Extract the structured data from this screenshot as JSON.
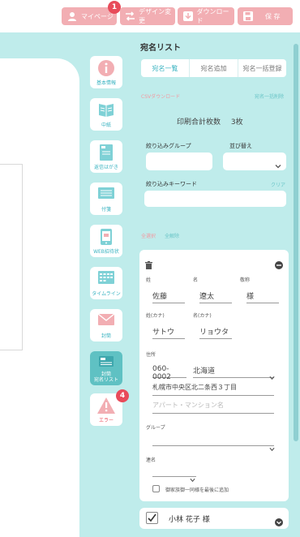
{
  "header": {
    "mypage_label": "マイページ",
    "design_change_label": "デザイン変更",
    "download_label": "ダウンロード",
    "save_label": "保 存",
    "mypage_badge": "1"
  },
  "nav": {
    "items": [
      {
        "label": "基本情報"
      },
      {
        "label": "中紙"
      },
      {
        "label": "返信はがき"
      },
      {
        "label": "付箋"
      },
      {
        "label": "WEB招待状"
      },
      {
        "label": "タイムライン"
      },
      {
        "label": "封筒"
      },
      {
        "label": "封筒\n宛名リスト"
      },
      {
        "label": "エラー"
      }
    ],
    "error_badge": "4"
  },
  "panel": {
    "title": "宛名リスト",
    "tabs": [
      {
        "label": "宛名一覧"
      },
      {
        "label": "宛名追加"
      },
      {
        "label": "宛名一括登録"
      }
    ],
    "csv_download": "CSVダウンロード",
    "bulk_delete": "宛名一括削除",
    "print_total_label": "印刷合計枚数",
    "print_total_value": "3枚",
    "filter_group_label": "絞り込みグループ",
    "sort_label": "並び替え",
    "keyword_label": "絞り込みキーワード",
    "clear_label": "クリア",
    "select_all": "全選択",
    "deselect_all": "全解除"
  },
  "recipient": {
    "last_name_label": "姓",
    "first_name_label": "名",
    "honorific_label": "敬称",
    "last_name": "佐藤",
    "first_name": "遼太",
    "honorific": "様",
    "last_kana_label": "姓(カナ)",
    "first_kana_label": "名(カナ)",
    "last_kana": "サトウ",
    "first_kana": "リョウタ",
    "address_label": "住所",
    "postal": "060-0002",
    "prefecture": "北海道",
    "address1": "札幌市中央区北二条西３丁目",
    "address2_placeholder": "アパート・マンション名",
    "group_label": "グループ",
    "joint_label": "連名",
    "same_title_label": "御家族御一同様を最後に追加"
  },
  "next_recipient": {
    "name": "小林 花子 様"
  },
  "colors": {
    "accent": "#3ab3c1",
    "canvas_bg": "#bfeceb",
    "header_button": "#f2aeb3",
    "badge": "#e84b5a"
  }
}
